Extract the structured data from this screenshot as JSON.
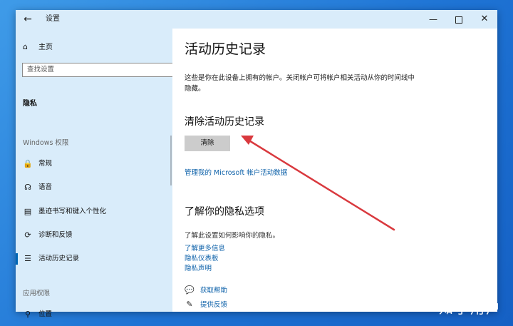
{
  "window": {
    "title": "设置",
    "back_icon": "←",
    "minimize_icon": "—",
    "close_icon": "✕"
  },
  "sidebar": {
    "home_label": "主页",
    "search_placeholder": "查找设置",
    "category": "隐私",
    "section_windows": "Windows 权限",
    "section_app": "应用权限",
    "items": [
      {
        "label": "常规",
        "icon": "🔒"
      },
      {
        "label": "语音",
        "icon": "☊"
      },
      {
        "label": "墨迹书写和键入个性化",
        "icon": "▤"
      },
      {
        "label": "诊断和反馈",
        "icon": "⟳"
      },
      {
        "label": "活动历史记录",
        "icon": "☰"
      },
      {
        "label": "位置",
        "icon": "⚲"
      }
    ]
  },
  "main": {
    "title": "活动历史记录",
    "description": "这些是你在此设备上拥有的帐户。关闭帐户可将帐户相关活动从你的时间线中隐藏。",
    "clear_heading": "清除活动历史记录",
    "clear_button": "清除",
    "manage_link": "管理我的 Microsoft 帐户活动数据",
    "privacy_heading": "了解你的隐私选项",
    "privacy_sub": "了解此设置如何影响你的隐私。",
    "links": [
      "了解更多信息",
      "隐私仪表板",
      "隐私声明"
    ],
    "help_label": "获取帮助",
    "feedback_label": "提供反馈"
  },
  "watermark": "知乎用户",
  "colors": {
    "accent": "#0066b4",
    "link": "#0a5fa8",
    "sidebar_bg": "#d9ecfa",
    "arrow": "#d9393e"
  }
}
